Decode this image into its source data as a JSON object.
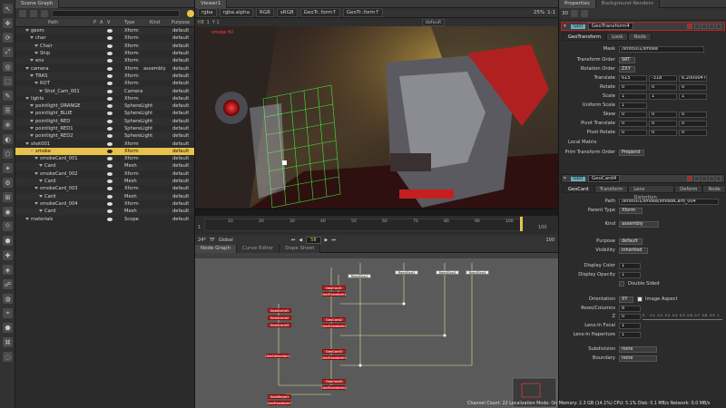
{
  "panels": {
    "scene_graph_tab": "Scene Graph",
    "viewer_tab": "Viewer1",
    "properties_tab": "Properties",
    "background_renders_tab": "Background Renders"
  },
  "scene_graph": {
    "columns": {
      "path": "Path",
      "p": "P",
      "a": "A",
      "v": "V",
      "type": "Type",
      "kind": "Kind",
      "purpose": "Purpose"
    },
    "rows": [
      {
        "name": "geom",
        "indent": 1,
        "type": "Xform",
        "kind": "",
        "purpose": "default"
      },
      {
        "name": "char",
        "indent": 2,
        "type": "Xform",
        "kind": "",
        "purpose": "default"
      },
      {
        "name": "Chair",
        "indent": 3,
        "type": "Xform",
        "kind": "",
        "purpose": "default"
      },
      {
        "name": "Ship",
        "indent": 3,
        "type": "Xform",
        "kind": "",
        "purpose": "default"
      },
      {
        "name": "env",
        "indent": 2,
        "type": "Xform",
        "kind": "",
        "purpose": "default"
      },
      {
        "name": "camera",
        "indent": 1,
        "type": "Xform",
        "kind": "assembly",
        "purpose": "default"
      },
      {
        "name": "TRAS",
        "indent": 2,
        "type": "Xform",
        "kind": "",
        "purpose": "default"
      },
      {
        "name": "ROT",
        "indent": 3,
        "type": "Xform",
        "kind": "",
        "purpose": "default"
      },
      {
        "name": "Shot_Cam_001",
        "indent": 4,
        "type": "Camera",
        "kind": "",
        "purpose": "default"
      },
      {
        "name": "lights",
        "indent": 1,
        "type": "Xform",
        "kind": "",
        "purpose": "default"
      },
      {
        "name": "pointlight_ORANGE",
        "indent": 2,
        "type": "SphereLight",
        "kind": "",
        "purpose": "default"
      },
      {
        "name": "pointlight_BLUE",
        "indent": 2,
        "type": "SphereLight",
        "kind": "",
        "purpose": "default"
      },
      {
        "name": "pointlight_RED",
        "indent": 2,
        "type": "SphereLight",
        "kind": "",
        "purpose": "default"
      },
      {
        "name": "pointlight_RED1",
        "indent": 2,
        "type": "SphereLight",
        "kind": "",
        "purpose": "default"
      },
      {
        "name": "pointlight_RED2",
        "indent": 2,
        "type": "SphereLight",
        "kind": "",
        "purpose": "default"
      },
      {
        "name": "shot001",
        "indent": 1,
        "type": "Xform",
        "kind": "",
        "purpose": "default"
      },
      {
        "name": "smoke",
        "indent": 2,
        "type": "Xform",
        "kind": "",
        "purpose": "default",
        "selected": true
      },
      {
        "name": "smokeCard_001",
        "indent": 3,
        "type": "Xform",
        "kind": "",
        "purpose": "default"
      },
      {
        "name": "Card",
        "indent": 4,
        "type": "Mesh",
        "kind": "",
        "purpose": "default"
      },
      {
        "name": "smokeCard_002",
        "indent": 3,
        "type": "Xform",
        "kind": "",
        "purpose": "default"
      },
      {
        "name": "Card",
        "indent": 4,
        "type": "Mesh",
        "kind": "",
        "purpose": "default"
      },
      {
        "name": "smokeCard_003",
        "indent": 3,
        "type": "Xform",
        "kind": "",
        "purpose": "default"
      },
      {
        "name": "Card",
        "indent": 4,
        "type": "Mesh",
        "kind": "",
        "purpose": "default"
      },
      {
        "name": "smokeCard_004",
        "indent": 3,
        "type": "Xform",
        "kind": "",
        "purpose": "default"
      },
      {
        "name": "Card",
        "indent": 4,
        "type": "Mesh",
        "kind": "",
        "purpose": "default"
      },
      {
        "name": "materials",
        "indent": 1,
        "type": "Scope",
        "kind": "",
        "purpose": "default"
      }
    ]
  },
  "viewer": {
    "channels": "rgba",
    "layer": "rgba.alpha",
    "colorspace": "RGB",
    "lut": "sRGB",
    "input_a": "GeoTr..form↑",
    "input_b": "GeoTr..form↑",
    "zoom": "25%",
    "scale": "1:1",
    "exposure": "f/8",
    "gain": "1",
    "gamma": "Y 1",
    "view_mode": "default",
    "overlay_label": "smoke fill",
    "fps": "24*",
    "tf": "TF",
    "tf_mode": "Global",
    "frame": "58",
    "end_frame": "100",
    "start_frame": "1",
    "timeline_ticks": [
      "10",
      "20",
      "30",
      "40",
      "50",
      "60",
      "70",
      "80",
      "90",
      "100"
    ]
  },
  "node_graph": {
    "tabs": [
      "Node Graph",
      "Curve Editor",
      "Dope Sheet"
    ],
    "nodes": [
      {
        "label": "GeoCard1",
        "type": "red"
      },
      {
        "label": "GeoTransform1",
        "type": "red"
      },
      {
        "label": "ReadGeo1",
        "type": "white"
      },
      {
        "label": "ReadGeo2",
        "type": "white"
      },
      {
        "label": "ReadGeo3",
        "type": "white"
      },
      {
        "label": "ReadGeo4",
        "type": "white"
      },
      {
        "label": "GeoScene1",
        "type": "red"
      },
      {
        "label": "GeoScene2",
        "type": "red"
      },
      {
        "label": "GeoScene3",
        "type": "red"
      },
      {
        "label": "GeoCard2",
        "type": "red"
      },
      {
        "label": "GeoTransform2",
        "type": "red"
      },
      {
        "label": "GeoCollection1",
        "type": "red"
      },
      {
        "label": "GeoCard3",
        "type": "red"
      },
      {
        "label": "GeoTransform3",
        "type": "red"
      },
      {
        "label": "GeoCard4",
        "type": "red"
      },
      {
        "label": "GeoTransform4",
        "type": "red"
      },
      {
        "label": "GeoMerge1",
        "type": "red"
      },
      {
        "label": "GeoTransform7",
        "type": "red"
      }
    ]
  },
  "properties": {
    "toolbar_number": "30",
    "node1": {
      "name": "GeoTransform4",
      "tabs": [
        "GeoTransform",
        "Look",
        "Node"
      ],
      "mask_label": "Mask",
      "mask_value": "/shot001/smoke",
      "transform_order_label": "Transform Order",
      "transform_order": "SRT",
      "rotation_order_label": "Rotation Order",
      "rotation_order": "ZXY",
      "translate_label": "Translate",
      "translate": [
        "615",
        "-318",
        "6.20000477"
      ],
      "rotate_label": "Rotate",
      "rotate": [
        "0",
        "0",
        "0"
      ],
      "scale_label": "Scale",
      "scale": [
        "1",
        "1",
        "1"
      ],
      "uniform_label": "Uniform Scale",
      "uniform": "1",
      "skew_label": "Skew",
      "skew": [
        "0",
        "0",
        "0"
      ],
      "pivot_t_label": "Pivot Translate",
      "pivot_t": [
        "0",
        "0",
        "0"
      ],
      "pivot_r_label": "Pivot Rotate",
      "pivot_r": [
        "0",
        "0",
        "0"
      ],
      "local_matrix": "Local Matrix",
      "prim_order_label": "Prim Transform Order",
      "prim_order": "Prepend"
    },
    "node2": {
      "name": "GeoCard4",
      "tabs": [
        "GeoCard",
        "Transform",
        "Lens Distortion",
        "Deform",
        "Node"
      ],
      "path_label": "Path",
      "path_value": "/shot001/smoke/smokeCard_004",
      "parent_type_label": "Parent Type",
      "parent_type": "Xform",
      "kind_label": "Kind",
      "kind": "assembly",
      "purpose_label": "Purpose",
      "purpose": "default",
      "visibility_label": "Visibility",
      "visibility": "inherited",
      "display_color_label": "Display Color",
      "display_color": "1",
      "display_opacity_label": "Display Opacity",
      "display_opacity": "1",
      "double_sided": "Double Sided",
      "orientation_label": "Orientation",
      "orientation": "XY",
      "image_aspect": "Image Aspect",
      "rows_label": "Rows/Columns",
      "rows": "8",
      "z_label": "Z",
      "z": "0",
      "focal_label": "Lens-In Focal",
      "focal": "1",
      "haperture_label": "Lens-In Haperture",
      "haperture": "1",
      "subdivision_label": "Subdivision",
      "subdivision": "none",
      "boundary_label": "Boundary",
      "boundary": "none",
      "slider_ticks": [
        "0",
        "0.1",
        "0.2",
        "0.3",
        "0.4",
        "0.5",
        "0.6",
        "0.7",
        "0.8",
        "0.9",
        "1"
      ]
    }
  },
  "status_bar": "Channel Count: 22 Localization Mode: On Memory: 2.3 GB (14.1%) CPU: 5.1% Disk: 0.1 MB/s Network: 0.0 MB/s",
  "colors": {
    "selection": "#e8c24c",
    "node_red": "#c32222",
    "grid_green": "#3cff3c",
    "accent_yellow": "#e8c24c"
  }
}
